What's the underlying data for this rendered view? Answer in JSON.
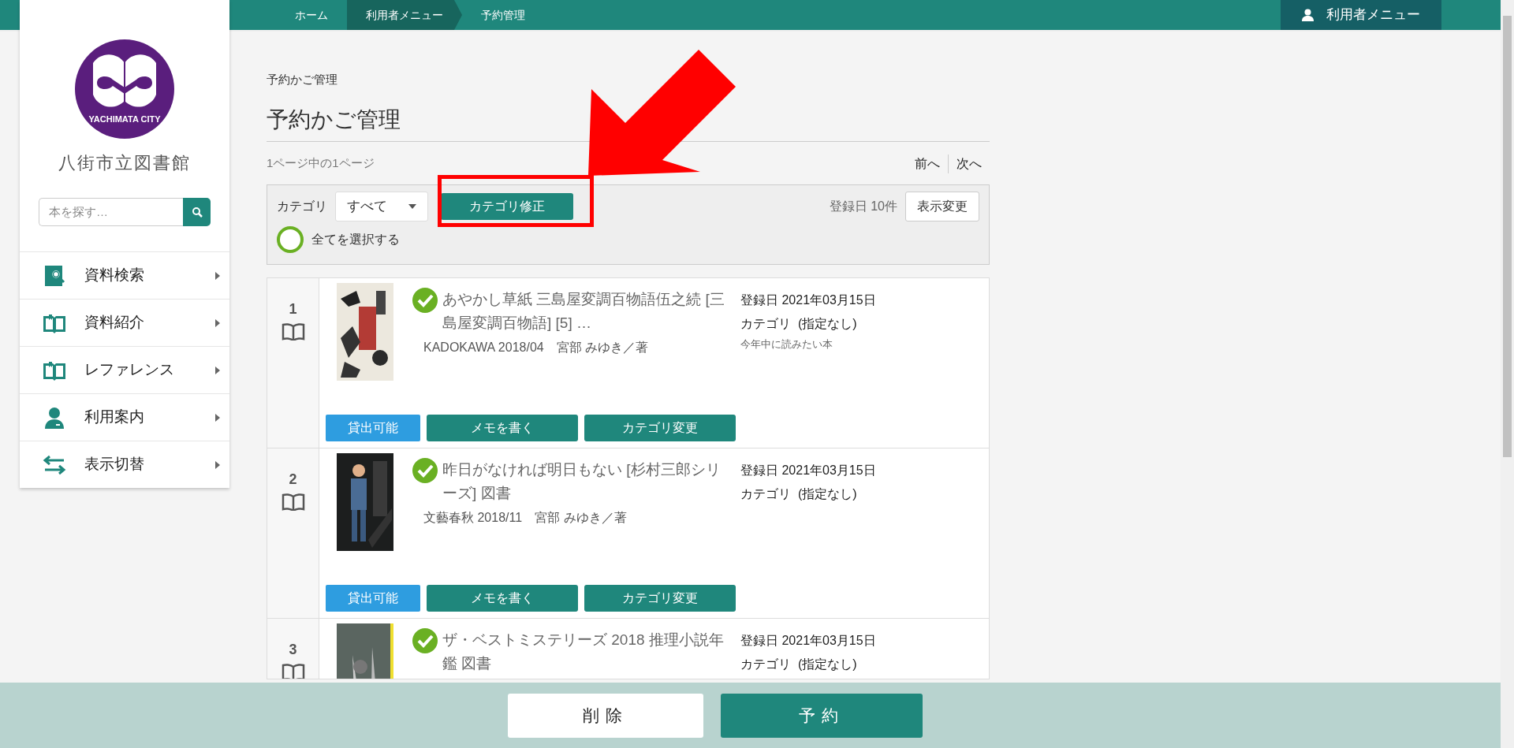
{
  "breadcrumbs": [
    {
      "label": "ホーム",
      "highlighted": false
    },
    {
      "label": "利用者メニュー",
      "highlighted": true
    },
    {
      "label": "予約管理",
      "highlighted": false
    }
  ],
  "user_menu": "利用者メニュー",
  "sidebar": {
    "logo_text": "YACHIMATA CITY",
    "library_name": "八街市立図書館",
    "search": {
      "placeholder": "本を探す…"
    },
    "items": [
      {
        "label": "資料検索",
        "kind": "search"
      },
      {
        "label": "資料紹介",
        "kind": "book"
      },
      {
        "label": "レファレンス",
        "kind": "book"
      },
      {
        "label": "利用案内",
        "kind": "person"
      },
      {
        "label": "表示切替",
        "kind": "switch"
      }
    ]
  },
  "page": {
    "breadcrumb": "予約かご管理",
    "title": "予約かご管理",
    "page_info": "1ページ中の1ページ",
    "pager": [
      "前へ",
      "次へ"
    ]
  },
  "filter": {
    "category_label": "カテゴリ",
    "category_value": "すべて",
    "fix_button": "カテゴリ修正",
    "sort_info": "登録日 10件",
    "display_button": "表示変更",
    "select_all": {
      "label": "全てを選択する",
      "checked": false
    }
  },
  "items": [
    {
      "number": "1",
      "checked": true,
      "title": "あやかし草紙 三島屋変調百物語伍之続 [三島屋変調百物語] [5] …",
      "publisher": "KADOKAWA 2018/04　宮部 みゆき／著",
      "registered": "登録日 2021年03月15日",
      "category": "カテゴリ  (指定なし)",
      "memo": "今年中に読みたい本",
      "status": "貸出可能",
      "buttons": [
        "メモを書く",
        "カテゴリ変更"
      ]
    },
    {
      "number": "2",
      "checked": true,
      "title": "昨日がなければ明日もない [杉村三郎シリーズ] 図書",
      "publisher": "文藝春秋 2018/11　宮部 みゆき／著",
      "registered": "登録日 2021年03月15日",
      "category": "カテゴリ  (指定なし)",
      "status": "貸出可能",
      "buttons": [
        "メモを書く",
        "カテゴリ変更"
      ]
    },
    {
      "number": "3",
      "checked": true,
      "title": "ザ・ベストミステリーズ 2018 推理小説年鑑 図書",
      "registered": "登録日 2021年03月15日",
      "category": "カテゴリ  (指定なし)"
    }
  ],
  "footer": {
    "buttons": [
      "削除",
      "予約"
    ]
  }
}
